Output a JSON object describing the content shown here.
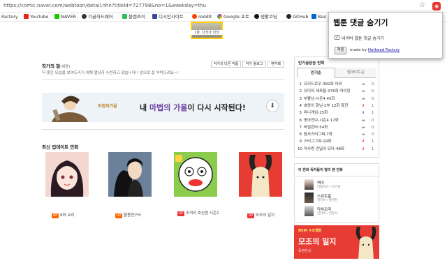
{
  "browser": {
    "url": "https://comic.naver.com/webtoon/detail.nhn?titleId=727798&no=1&weekday=thu"
  },
  "bookmarks": [
    {
      "label": "Factory",
      "color": "#666"
    },
    {
      "label": "YouTube",
      "color": "#e62117"
    },
    {
      "label": "NAVER",
      "color": "#1ec800"
    },
    {
      "label": "기글하드웨어",
      "color": "#333"
    },
    {
      "label": "블랜조이",
      "color": "#2dbe60"
    },
    {
      "label": "디시인사이트",
      "color": "#3b4890"
    },
    {
      "label": "reddit",
      "color": "#ff4500"
    },
    {
      "label": "Google 포토",
      "color": "#fbbc05"
    },
    {
      "label": "생활코딩",
      "color": "#111"
    },
    {
      "label": "GitHub",
      "color": "#24292e"
    },
    {
      "label": "Bas",
      "color": "#0066cc"
    }
  ],
  "top_thumb_caption": "1화. 다섯과 다섯",
  "author": {
    "title": "작가의 말",
    "name": "(세윤)",
    "message": "더 좋은 모습을 보여드리기 위해 열심히 수련하고 왔습니다!! 앞으로 잘 부탁드려요~!",
    "buttons": [
      "작가의 다른 작품",
      "작가 블로그",
      "팬카페"
    ]
  },
  "banner": {
    "logo_text": "마법의가을",
    "text_pre": "내 ",
    "text_highlight": "마법의 가을",
    "text_post": "이 다시 시작된다!"
  },
  "latest": {
    "title": "최신 업데이트 만화",
    "items": [
      {
        "badge": "UP",
        "badge_color": "#ff6600",
        "title": "8화 요리"
      },
      {
        "badge": "UP",
        "badge_color": "#ff6600",
        "title": "물몽연구소"
      },
      {
        "badge": "UP",
        "badge_color": "#e33",
        "title": "조석의 호신원 시즌2"
      },
      {
        "badge": "UP",
        "badge_color": "#e33",
        "title": "모조의 일지"
      }
    ]
  },
  "popular": {
    "title": "인기급상승 만화",
    "tabs": [
      "인기순",
      "업데이트순"
    ],
    "rows": [
      {
        "n": "1",
        "title": "프리드로우-382화 마외",
        "arrow": "▬",
        "color": "#888",
        "change": "0"
      },
      {
        "n": "2",
        "title": "유미의 세포들-376화 마이킹",
        "arrow": "▬",
        "color": "#888",
        "change": "0"
      },
      {
        "n": "3",
        "title": "부활남-시즌4 45화",
        "arrow": "▬",
        "color": "#888",
        "change": "0"
      },
      {
        "n": "4",
        "title": "호랑이 형님-2부 12화 흑천",
        "arrow": "⬆",
        "color": "#e33",
        "change": "1"
      },
      {
        "n": "5",
        "title": "머니게임-25화",
        "arrow": "⬇",
        "color": "#3366cc",
        "change": "1"
      },
      {
        "n": "6",
        "title": "동아전다-시즌4 17화",
        "arrow": "▬",
        "color": "#888",
        "change": "0"
      },
      {
        "n": "7",
        "title": "바질란타-54화",
        "arrow": "▬",
        "color": "#888",
        "change": "0"
      },
      {
        "n": "8",
        "title": "참사스터그찌-7화",
        "arrow": "▬",
        "color": "#888",
        "change": "0"
      },
      {
        "n": "9",
        "title": "스터그그찌-19화",
        "arrow": "⬆",
        "color": "#e33",
        "change": "1"
      },
      {
        "n": "10",
        "title": "작사랑 견딜이 되다-48화",
        "arrow": "⬆",
        "color": "#e33",
        "change": "1"
      }
    ]
  },
  "also_read": {
    "title": "이 만화 독자들이 많이 본 만화",
    "items": [
      {
        "title": "액미",
        "sub": "미술작가 / 작가명"
      },
      {
        "title": "스위트홈",
        "sub": "김칸비 / 황영찬"
      },
      {
        "title": "닥치오리",
        "sub": "김칸비 / 전필식"
      }
    ]
  },
  "ad": {
    "tag": "NEW 수요웹툰",
    "title": "모조의 일지",
    "author": "동영만상"
  },
  "extension_popup": {
    "title": "웹툰 댓글 숨기기",
    "checkbox_label": "네이버 웹툰 댓글 숨기기",
    "checked": true,
    "apply_button": "적용",
    "made_by": "made by ",
    "link": "Hothead Factory"
  }
}
